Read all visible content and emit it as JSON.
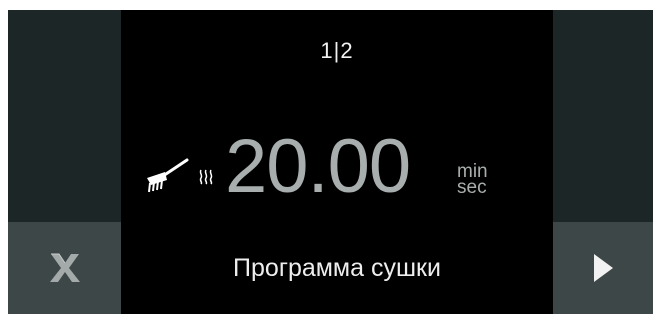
{
  "page_indicator": "1|2",
  "timer": {
    "value": "20.00",
    "unit_top": "min",
    "unit_bottom": "sec"
  },
  "program_name": "Программа сушки",
  "icons": {
    "left_button": "close-icon",
    "right_button": "play-arrow-icon",
    "program_icon": "brush-icon",
    "mode_icon": "steam-icon"
  },
  "colors": {
    "background": "#000000",
    "side_panel": "#1c2626",
    "side_button": "#3e4747",
    "timer_text": "#a8adad",
    "label_text": "#eeeeee"
  }
}
